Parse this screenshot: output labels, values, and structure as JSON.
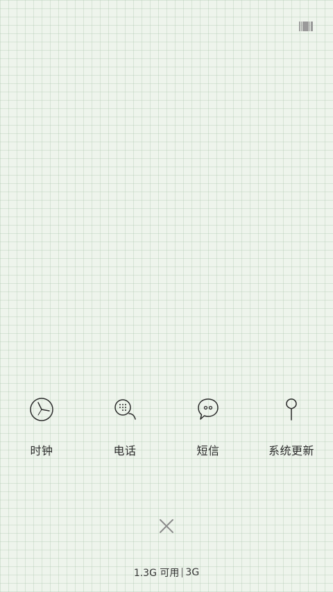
{
  "top_bar": {
    "icon": "barcode-icon"
  },
  "dock": {
    "apps": [
      {
        "label": "时钟",
        "icon": "clock-icon"
      },
      {
        "label": "电话",
        "icon": "phone-icon"
      },
      {
        "label": "短信",
        "icon": "message-icon"
      },
      {
        "label": "系统更新",
        "icon": "update-icon"
      }
    ]
  },
  "close": {
    "icon": "close-icon"
  },
  "status": {
    "memory": "1.3G 可用",
    "network": "3G"
  },
  "colors": {
    "background": "#eef4ec",
    "grid": "#a0bea0",
    "icon_stroke": "#2a2a2a"
  }
}
